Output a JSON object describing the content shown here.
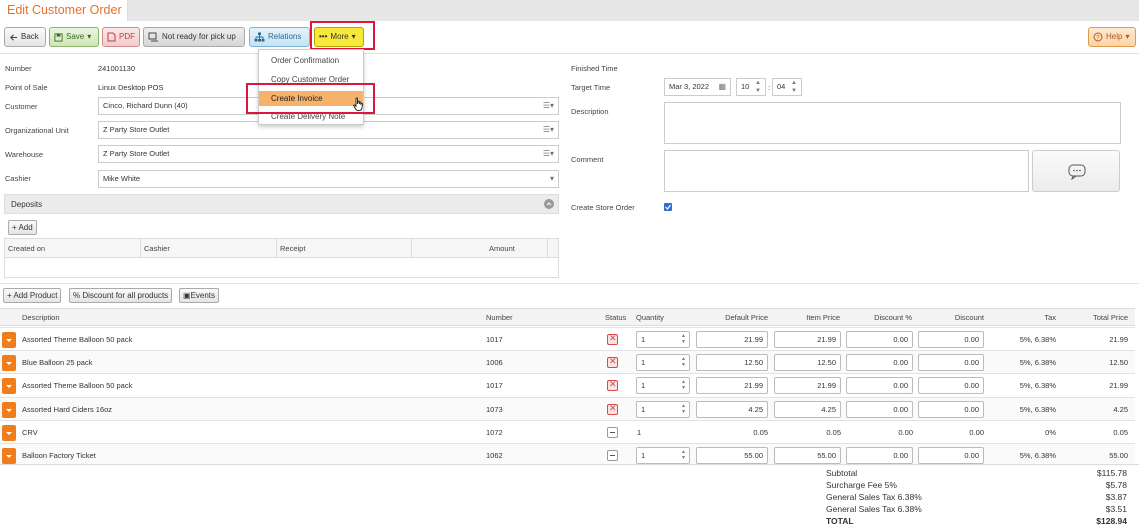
{
  "tab": {
    "title": "Edit Customer Order"
  },
  "toolbar": {
    "back": "Back",
    "save": "Save",
    "pdf": "PDF",
    "not_ready": "Not ready for pick up",
    "relations": "Relations",
    "more": "More",
    "help": "Help"
  },
  "more_menu": {
    "items": [
      "Order Confirmation",
      "Copy Customer Order",
      "Create Invoice",
      "Create Delivery Note"
    ],
    "highlighted": "Create Invoice"
  },
  "form": {
    "number_label": "Number",
    "number": "241001130",
    "pos_label": "Point of Sale",
    "pos": "Linux Desktop POS",
    "customer_label": "Customer",
    "customer": "Cinco, Richard Dunn (40)",
    "org_label": "Organizational Unit",
    "org": "Z Party Store Outlet",
    "warehouse_label": "Warehouse",
    "warehouse": "Z Party Store Outlet",
    "cashier_label": "Cashier",
    "cashier": "Mike White",
    "finished_label": "Finished Time",
    "target_label": "Target Time",
    "target_date": "Mar 3, 2022",
    "target_hour": "10",
    "target_min": "04",
    "description_label": "Description",
    "comment_label": "Comment",
    "store_order_label": "Create Store Order",
    "store_order_checked": true
  },
  "deposits": {
    "title": "Deposits",
    "add": "Add",
    "columns": [
      "Created on",
      "Cashier",
      "Receipt",
      "Amount"
    ]
  },
  "product_toolbar": {
    "add_product": "Add Product",
    "discount_all": "Discount for all products",
    "events": "Events"
  },
  "products": {
    "columns": [
      "Description",
      "Number",
      "Status",
      "Quantity",
      "Default Price",
      "Item Price",
      "Discount %",
      "Discount",
      "Tax",
      "Total Price"
    ],
    "rows": [
      {
        "desc": "Assorted Theme Balloon 50 pack",
        "number": "1017",
        "status": "x",
        "qty": "1",
        "default_price": "21.99",
        "item_price": "21.99",
        "disc_pct": "0.00",
        "disc": "0.00",
        "tax": "5%, 6.38%",
        "total": "21.99",
        "editable": true
      },
      {
        "desc": "Blue Balloon 25 pack",
        "number": "1006",
        "status": "x",
        "qty": "1",
        "default_price": "12.50",
        "item_price": "12.50",
        "disc_pct": "0.00",
        "disc": "0.00",
        "tax": "5%, 6.38%",
        "total": "12.50",
        "editable": true
      },
      {
        "desc": "Assorted Theme Balloon 50 pack",
        "number": "1017",
        "status": "x",
        "qty": "1",
        "default_price": "21.99",
        "item_price": "21.99",
        "disc_pct": "0.00",
        "disc": "0.00",
        "tax": "5%, 6.38%",
        "total": "21.99",
        "editable": true
      },
      {
        "desc": "Assorted Hard Ciders 16oz",
        "number": "1073",
        "status": "x",
        "qty": "1",
        "default_price": "4.25",
        "item_price": "4.25",
        "disc_pct": "0.00",
        "disc": "0.00",
        "tax": "5%, 6.38%",
        "total": "4.25",
        "editable": true
      },
      {
        "desc": "CRV",
        "number": "1072",
        "status": "dash",
        "qty": "1",
        "default_price": "0.05",
        "item_price": "0.05",
        "disc_pct": "0.00",
        "disc": "0.00",
        "tax": "0%",
        "total": "0.05",
        "editable": false
      },
      {
        "desc": "Balloon Factory Ticket",
        "number": "1062",
        "status": "dash",
        "qty": "1",
        "default_price": "55.00",
        "item_price": "55.00",
        "disc_pct": "0.00",
        "disc": "0.00",
        "tax": "5%, 6.38%",
        "total": "55.00",
        "editable": true
      }
    ]
  },
  "totals": [
    {
      "label": "Subtotal",
      "value": "$115.78"
    },
    {
      "label": "Surcharge Fee 5%",
      "value": "$5.78"
    },
    {
      "label": "General Sales Tax 6.38%",
      "value": "$3.87"
    },
    {
      "label": "General Sales Tax 6.38%",
      "value": "$3.51"
    },
    {
      "label": "TOTAL",
      "value": "$128.94"
    }
  ]
}
